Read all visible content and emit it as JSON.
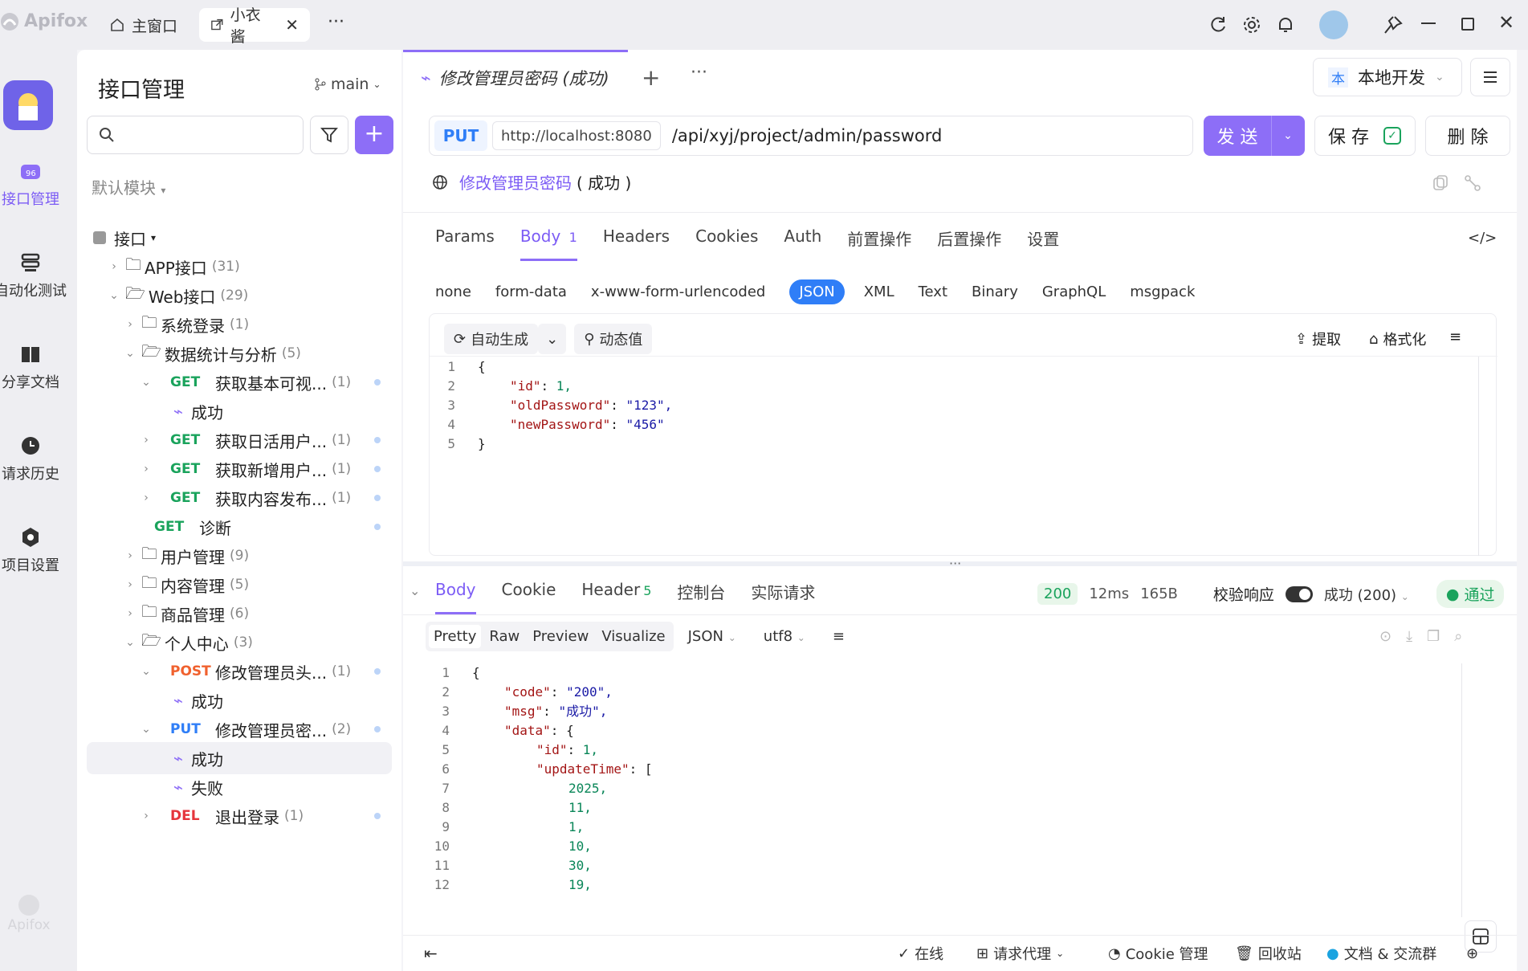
{
  "titlebar": {
    "app_name": "Apifox",
    "tabs": [
      {
        "label": "主窗口"
      },
      {
        "label": "小衣酱"
      }
    ]
  },
  "rail": {
    "items": [
      {
        "label": "接口管理"
      },
      {
        "label": "自动化测试"
      },
      {
        "label": "分享文档"
      },
      {
        "label": "请求历史"
      },
      {
        "label": "项目设置"
      }
    ],
    "footer_logo": "Apifox"
  },
  "sidebar": {
    "title": "接口管理",
    "branch": "main",
    "module": "默认模块",
    "tree": [
      {
        "label": "接口",
        "count": ""
      },
      {
        "label": "APP接口",
        "count": "(31)"
      },
      {
        "label": "Web接口",
        "count": "(29)"
      },
      {
        "label": "系统登录",
        "count": "(1)"
      },
      {
        "label": "数据统计与分析",
        "count": "(5)"
      },
      {
        "method": "GET",
        "label": "获取基本可视...",
        "count": "(1)"
      },
      {
        "label": "成功"
      },
      {
        "method": "GET",
        "label": "获取日活用户...",
        "count": "(1)"
      },
      {
        "method": "GET",
        "label": "获取新增用户...",
        "count": "(1)"
      },
      {
        "method": "GET",
        "label": "获取内容发布...",
        "count": "(1)"
      },
      {
        "method": "GET",
        "label": "诊断",
        "count": ""
      },
      {
        "label": "用户管理",
        "count": "(9)"
      },
      {
        "label": "内容管理",
        "count": "(5)"
      },
      {
        "label": "商品管理",
        "count": "(6)"
      },
      {
        "label": "个人中心",
        "count": "(3)"
      },
      {
        "method": "POST",
        "label": "修改管理员头...",
        "count": "(1)"
      },
      {
        "label": "成功"
      },
      {
        "method": "PUT",
        "label": "修改管理员密...",
        "count": "(2)"
      },
      {
        "label": "成功"
      },
      {
        "label": "失败"
      },
      {
        "method": "DEL",
        "label": "退出登录",
        "count": "(1)"
      }
    ]
  },
  "main": {
    "tab_title": "修改管理员密码 (成功)",
    "env": {
      "badge": "本",
      "label": "本地开发"
    },
    "request": {
      "method": "PUT",
      "base_url": "http://localhost:8080",
      "path": "/api/xyj/project/admin/password",
      "send": "发 送",
      "save": "保 存",
      "delete": "删 除"
    },
    "name": "修改管理员密码",
    "name_suffix": "( 成功 )",
    "req_tabs": [
      "Params",
      "Body",
      "Headers",
      "Cookies",
      "Auth",
      "前置操作",
      "后置操作",
      "设置"
    ],
    "body_count": "1",
    "body_types": [
      "none",
      "form-data",
      "x-www-form-urlencoded",
      "JSON",
      "XML",
      "Text",
      "Binary",
      "GraphQL",
      "msgpack"
    ],
    "editor_tools": {
      "auto": "自动生成",
      "dynamic": "动态值",
      "extract": "提取",
      "format": "格式化"
    },
    "request_body": [
      {
        "ln": "1",
        "text": "{"
      },
      {
        "ln": "2",
        "key": "\"id\"",
        "val": "1,"
      },
      {
        "ln": "3",
        "key": "\"oldPassword\"",
        "val": "\"123\","
      },
      {
        "ln": "4",
        "key": "\"newPassword\"",
        "val": "\"456\""
      },
      {
        "ln": "5",
        "text": "}"
      }
    ],
    "resp_tabs": [
      "Body",
      "Cookie",
      "Header",
      "控制台",
      "实际请求"
    ],
    "header_count": "5",
    "resp_status": "200",
    "resp_time": "12ms",
    "resp_size": "165B",
    "validate_label": "校验响应",
    "success_select": "成功 (200)",
    "pass_label": "通过",
    "view_modes": [
      "Pretty",
      "Raw",
      "Preview",
      "Visualize"
    ],
    "format": "JSON",
    "encoding": "utf8",
    "response_body": [
      {
        "ln": "1",
        "text": "{"
      },
      {
        "ln": "2",
        "key": "\"code\"",
        "val": "\"200\","
      },
      {
        "ln": "3",
        "key": "\"msg\"",
        "val": "\"成功\","
      },
      {
        "ln": "4",
        "key": "\"data\"",
        "val": "{"
      },
      {
        "ln": "5",
        "key": "\"id\"",
        "val": "1,"
      },
      {
        "ln": "6",
        "key": "\"updateTime\"",
        "val": "["
      },
      {
        "ln": "7",
        "num": "2025,"
      },
      {
        "ln": "8",
        "num": "11,"
      },
      {
        "ln": "9",
        "num": "1,"
      },
      {
        "ln": "10",
        "num": "10,"
      },
      {
        "ln": "11",
        "num": "30,"
      },
      {
        "ln": "12",
        "num": "19,"
      }
    ],
    "status_bar": {
      "online": "在线",
      "proxy": "请求代理",
      "cookie": "Cookie 管理",
      "trash": "回收站",
      "docs": "文档 & 交流群"
    }
  }
}
